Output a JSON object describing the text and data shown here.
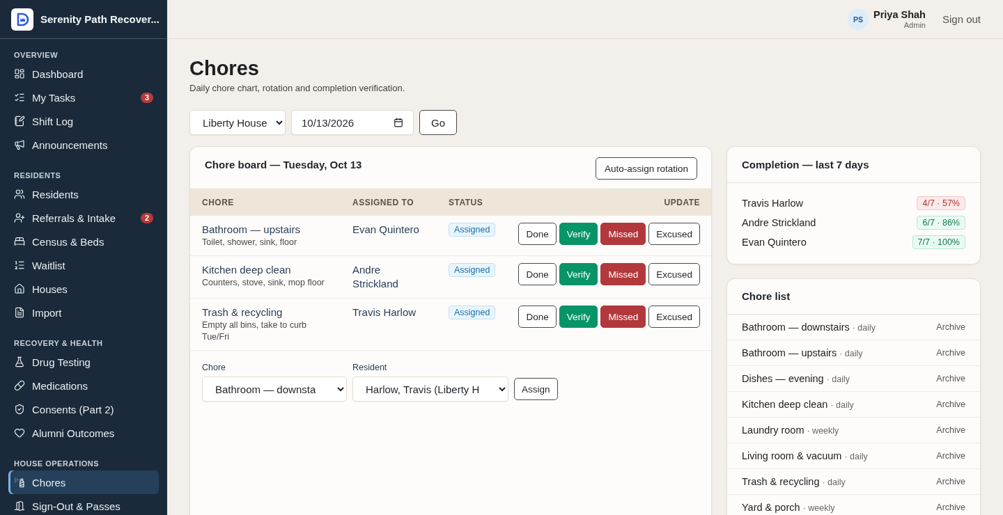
{
  "sidebar": {
    "brand": "Serenity Path Recover...",
    "sections": [
      {
        "title": "OVERVIEW",
        "items": [
          {
            "label": "Dashboard",
            "selected": false
          },
          {
            "label": "My Tasks",
            "selected": false,
            "badge": "3"
          },
          {
            "label": "Shift Log",
            "selected": false
          },
          {
            "label": "Announcements",
            "selected": false
          }
        ]
      },
      {
        "title": "RESIDENTS",
        "items": [
          {
            "label": "Residents",
            "selected": false
          },
          {
            "label": "Referrals & Intake",
            "selected": false,
            "badge": "2"
          },
          {
            "label": "Census & Beds",
            "selected": false
          },
          {
            "label": "Waitlist",
            "selected": false
          },
          {
            "label": "Houses",
            "selected": false
          },
          {
            "label": "Import",
            "selected": false
          }
        ]
      },
      {
        "title": "RECOVERY & HEALTH",
        "items": [
          {
            "label": "Drug Testing",
            "selected": false
          },
          {
            "label": "Medications",
            "selected": false
          },
          {
            "label": "Consents (Part 2)",
            "selected": false
          },
          {
            "label": "Alumni Outcomes",
            "selected": false
          }
        ]
      },
      {
        "title": "HOUSE OPERATIONS",
        "items": [
          {
            "label": "Chores",
            "selected": true
          },
          {
            "label": "Sign-Out & Passes",
            "selected": false
          }
        ]
      }
    ]
  },
  "header": {
    "user": {
      "initials": "PS",
      "name": "Priya Shah",
      "role": "Admin"
    },
    "sign_out": "Sign out"
  },
  "page": {
    "title": "Chores",
    "subtitle": "Daily chore chart, rotation and completion verification."
  },
  "filters": {
    "house": "Liberty House",
    "date": "10/13/2026",
    "go": "Go"
  },
  "chore_board": {
    "title": "Chore board — Tuesday, Oct 13",
    "auto_assign": "Auto-assign rotation",
    "columns": [
      "CHORE",
      "ASSIGNED TO",
      "STATUS",
      "UPDATE"
    ],
    "rows": [
      {
        "chore": "Bathroom — upstairs",
        "detail": "Toilet, shower, sink, floor",
        "assignee": "Evan Quintero",
        "status": "Assigned",
        "actions": [
          {
            "label": "Done",
            "kind": "outline"
          },
          {
            "label": "Verify",
            "kind": "success"
          },
          {
            "label": "Missed",
            "kind": "danger"
          },
          {
            "label": "Excused",
            "kind": "outline"
          }
        ]
      },
      {
        "chore": "Kitchen deep clean",
        "detail": "Counters, stove, sink, mop floor",
        "assignee": "Andre Strickland",
        "status": "Assigned",
        "actions": [
          {
            "label": "Done",
            "kind": "outline"
          },
          {
            "label": "Verify",
            "kind": "success"
          },
          {
            "label": "Missed",
            "kind": "danger"
          },
          {
            "label": "Excused",
            "kind": "outline"
          }
        ]
      },
      {
        "chore": "Trash & recycling",
        "detail": "Empty all bins, take to curb Tue/Fri",
        "assignee": "Travis Harlow",
        "status": "Assigned",
        "actions": [
          {
            "label": "Done",
            "kind": "outline"
          },
          {
            "label": "Verify",
            "kind": "success"
          },
          {
            "label": "Missed",
            "kind": "danger"
          },
          {
            "label": "Excused",
            "kind": "outline"
          }
        ]
      }
    ],
    "assign_form": {
      "chore_label": "Chore",
      "chore_value": "Bathroom — downsta",
      "resident_label": "Resident",
      "resident_value": "Harlow, Travis (Liberty H",
      "button": "Assign"
    }
  },
  "completion": {
    "title": "Completion — last 7 days",
    "rows": [
      {
        "name": "Travis Harlow",
        "score": "4/7 · 57%",
        "kind": "low"
      },
      {
        "name": "Andre Strickland",
        "score": "6/7 · 86%",
        "kind": "high"
      },
      {
        "name": "Evan Quintero",
        "score": "7/7 · 100%",
        "kind": "high"
      }
    ]
  },
  "chore_list": {
    "title": "Chore list",
    "items": [
      {
        "name": "Bathroom — downstairs",
        "frequency": "· daily",
        "action": "Archive"
      },
      {
        "name": "Bathroom — upstairs",
        "frequency": "· daily",
        "action": "Archive"
      },
      {
        "name": "Dishes — evening",
        "frequency": "· daily",
        "action": "Archive"
      },
      {
        "name": "Kitchen deep clean",
        "frequency": "· daily",
        "action": "Archive"
      },
      {
        "name": "Laundry room",
        "frequency": "· weekly",
        "action": "Archive"
      },
      {
        "name": "Living room & vacuum",
        "frequency": "· daily",
        "action": "Archive"
      },
      {
        "name": "Trash & recycling",
        "frequency": "· daily",
        "action": "Archive"
      },
      {
        "name": "Yard & porch",
        "frequency": "· weekly",
        "action": "Archive"
      }
    ]
  }
}
